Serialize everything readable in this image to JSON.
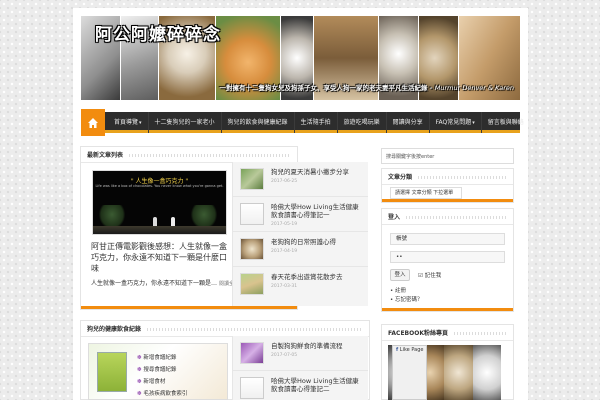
{
  "header": {
    "site_title": "阿公阿嬤碎碎念",
    "tagline": "一對擁有十二隻狗女兒及狗孫子女、享受人狗一家的老夫妻平凡生活紀錄 -",
    "signature": "Murmur Denver & Karen"
  },
  "nav": {
    "items": [
      {
        "label": "首頁導覽",
        "has_caret": true
      },
      {
        "label": "十二隻狗兒的一家老小",
        "has_caret": false
      },
      {
        "label": "狗兒的飲食與健康紀錄",
        "has_caret": false
      },
      {
        "label": "生活隨手拍",
        "has_caret": false
      },
      {
        "label": "旅遊吃喝玩樂",
        "has_caret": false
      },
      {
        "label": "閱讀與分享",
        "has_caret": false
      },
      {
        "label": "FAQ常見問題",
        "has_caret": true
      },
      {
        "label": "留言板與聯絡",
        "has_caret": false
      }
    ]
  },
  "box1": {
    "heading": "最新文章列表",
    "featured": {
      "image_caption": "\" 人生像一盒巧克力 \"",
      "image_subcaption": "Life was like a box of chocolates. You never know what you're gonna get.",
      "title": "阿甘正傳電影觀後感想：人生就像一盒巧克力，你永遠不知道下一顆是什麼口味",
      "meta": "0",
      "excerpt": "人生就像一盒巧克力，你永遠不知道下一顆是…",
      "more": "閱讀全文 »"
    },
    "side": [
      {
        "title": "狗兒的夏天消暑小撇步分享",
        "date": "2017-06-25"
      },
      {
        "title": "哈佛大學How Living生活健康飲食讀書心得筆記一",
        "date": "2017-05-19"
      },
      {
        "title": "老狗狗的日常照護心得",
        "date": "2017-04-19"
      },
      {
        "title": "春天花季出遊賞花散步去",
        "date": "2017-03-31"
      }
    ]
  },
  "box2": {
    "heading": "狗兒的健康飲食紀錄",
    "menu": [
      "新增食譜紀錄",
      "搜尋食譜紀錄",
      "新增食材",
      "毛孩疾病飲食索引"
    ],
    "side": [
      {
        "title": "自製狗狗鮮食的準備流程",
        "date": "2017-07-05"
      },
      {
        "title": "哈佛大學How Living生活健康飲食讀書心得筆記二",
        "date": ""
      }
    ]
  },
  "sidebar": {
    "search_placeholder": "搜尋關鍵字後按enter",
    "categories_heading": "文章分類",
    "categories_select": "請選擇 文章分類 下拉選單",
    "login_heading": "登入",
    "username_value": "帳號",
    "password_value": "••",
    "login_button": "登入",
    "remember_label": "記住我",
    "links": [
      "註冊",
      "忘記密碼？"
    ],
    "facebook_heading": "FACEBOOK粉絲專頁",
    "like_page": "Like Page"
  },
  "colors": {
    "accent": "#f28c0f",
    "nav_bg": "#2d2d2d"
  }
}
